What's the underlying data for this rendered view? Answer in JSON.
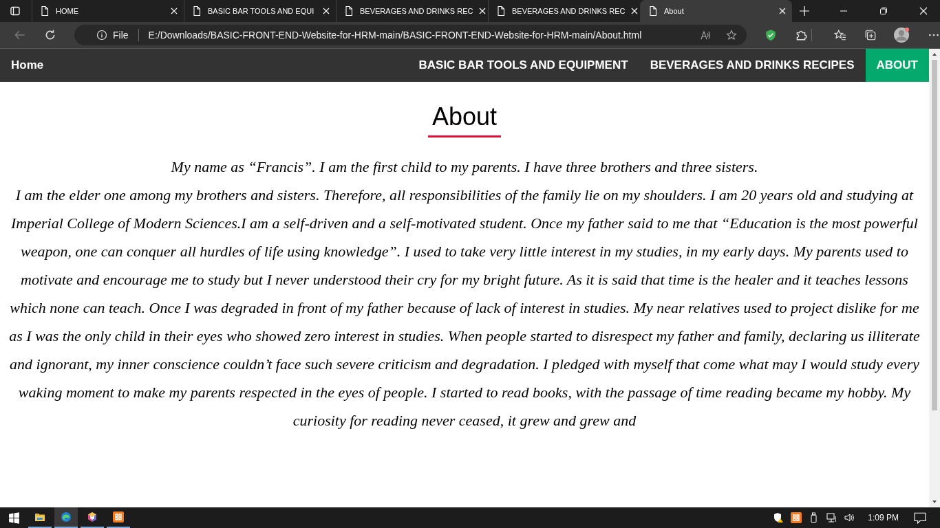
{
  "browser": {
    "tabs": [
      {
        "title": "HOME",
        "selected": false
      },
      {
        "title": "BASIC BAR TOOLS AND EQUI",
        "selected": false
      },
      {
        "title": "BEVERAGES AND DRINKS REC",
        "selected": false
      },
      {
        "title": "BEVERAGES AND DRINKS REC",
        "selected": false
      },
      {
        "title": "About",
        "selected": true
      }
    ],
    "address": {
      "scheme": "File",
      "url": "E:/Downloads/BASIC-FRONT-END-Website-for-HRM-main/BASIC-FRONT-END-Website-for-HRM-main/About.html"
    }
  },
  "nav": {
    "home": "Home",
    "links": [
      {
        "label": "BASIC BAR TOOLS AND EQUIPMENT",
        "selected": false
      },
      {
        "label": "BEVERAGES AND DRINKS RECIPES",
        "selected": false
      },
      {
        "label": "ABOUT",
        "selected": true
      }
    ]
  },
  "page": {
    "heading": "About",
    "paragraphs": [
      "My name as “Francis”. I am the first child to my parents. I have three brothers and three sisters.",
      "I am the elder one among my brothers and sisters. Therefore, all responsibilities of the family lie on my shoulders. I am 20 years old and studying at Imperial College of Modern Sciences.I am a self-driven and a self-motivated student. Once my father said to me that “Education is the most powerful weapon, one can conquer all hurdles of life using knowledge”. I used to take very little interest in my studies, in my early days. My parents used to motivate and encourage me to study but I never understood their cry for my bright future. As it is said that time is the healer and it teaches lessons which none can teach. Once I was degraded in front of my father because of lack of interest in studies. My near relatives used to project dislike for me as I was the only child in their eyes who showed zero interest in studies. When people started to disrespect my father and family, declaring us illiterate and ignorant, my inner conscience couldn’t face such severe criticism and degradation. I pledged with myself that come what may I would study every waking moment to make my parents respected in the eyes of people. I started to read books, with the passage of time reading became my hobby. My curiosity for reading never ceased, it grew and grew and"
    ]
  },
  "taskbar": {
    "apps": [
      {
        "selected": false
      },
      {
        "selected": true
      },
      {
        "selected": false
      },
      {
        "selected": false
      }
    ],
    "time": "1:09 PM"
  }
}
